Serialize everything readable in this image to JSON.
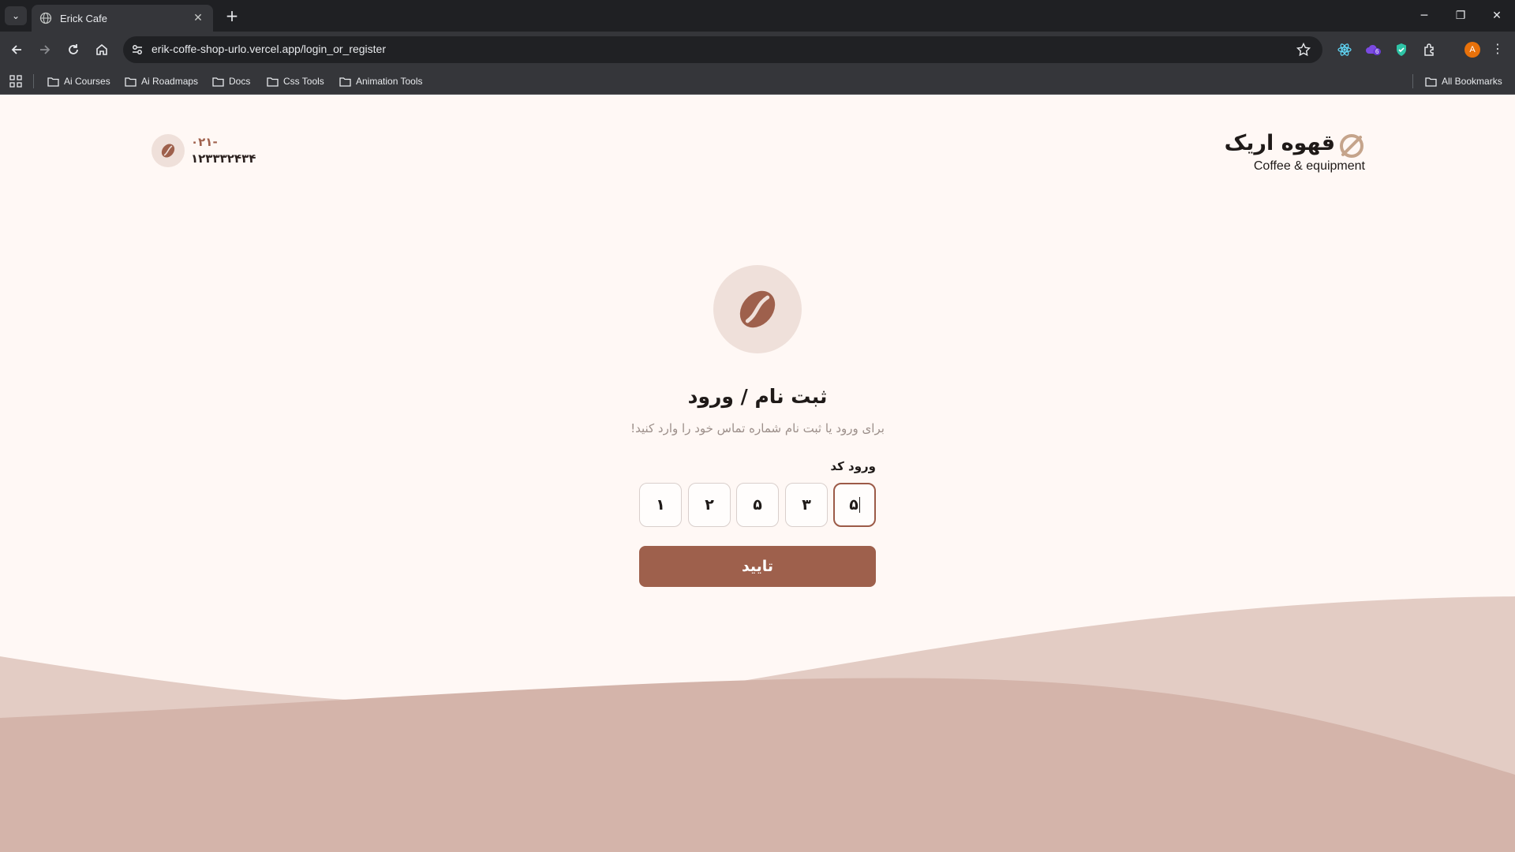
{
  "browser": {
    "tab_title": "Erick Cafe",
    "url": "erik-coffe-shop-urlo.vercel.app/login_or_register",
    "extension_badge": "6",
    "profile_initial": "A",
    "bookmarks": [
      "Ai Courses",
      "Ai Roadmaps",
      "Docs",
      "Css Tools",
      "Animation Tools"
    ],
    "all_bookmarks_label": "All Bookmarks"
  },
  "header": {
    "phone_prefix": "۰۲۱-",
    "phone_number": "۱۲۳۳۳۲۴۳۴",
    "logo_text": "قهوه اریک",
    "logo_tagline": "Coffee & equipment"
  },
  "auth": {
    "title": "ثبت نام / ورود",
    "subtitle": "برای ورود یا ثبت نام شماره تماس خود را وارد کنید!",
    "otp_label": "ورود کد",
    "otp_digits": [
      "۱",
      "۲",
      "۵",
      "۳",
      "۵"
    ],
    "submit_label": "تایید"
  },
  "colors": {
    "brand": "#9e604c",
    "background": "#fff8f5",
    "wave_light": "#e3ccc4",
    "wave_dark": "#d4b4aa"
  }
}
